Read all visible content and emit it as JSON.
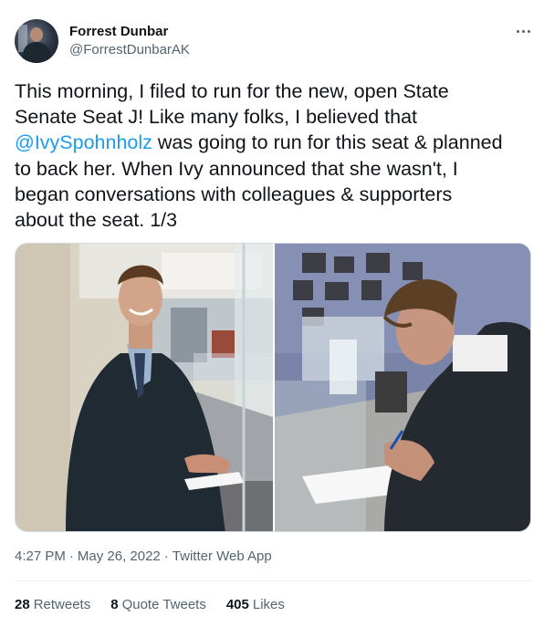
{
  "author": {
    "name": "Forrest Dunbar",
    "handle": "@ForrestDunbarAK"
  },
  "tweet": {
    "lines": [
      {
        "text": "This morning, I filed to run for the new, open State"
      },
      {
        "text": "Senate Seat J! Like many folks, I believed that"
      },
      {
        "mention": "@IvySpohnholz",
        "text": " was going to run for this seat & planned"
      },
      {
        "text": "to back her. When Ivy announced that she wasn't, I"
      },
      {
        "text": "began conversations with colleagues & supporters"
      },
      {
        "text": "about the seat. 1/3"
      }
    ]
  },
  "meta": {
    "time": "4:27 PM",
    "date": "May 26, 2022",
    "app": "Twitter Web App",
    "separator": "·"
  },
  "stats": {
    "retweets_count": "28",
    "retweets_label": "Retweets",
    "quotes_count": "8",
    "quotes_label": "Quote Tweets",
    "likes_count": "405",
    "likes_label": "Likes"
  },
  "icons": {
    "more": "more-options-icon"
  },
  "colors": {
    "link": "#1d9bf0",
    "secondary_text": "#536471",
    "primary_text": "#0f1419"
  }
}
